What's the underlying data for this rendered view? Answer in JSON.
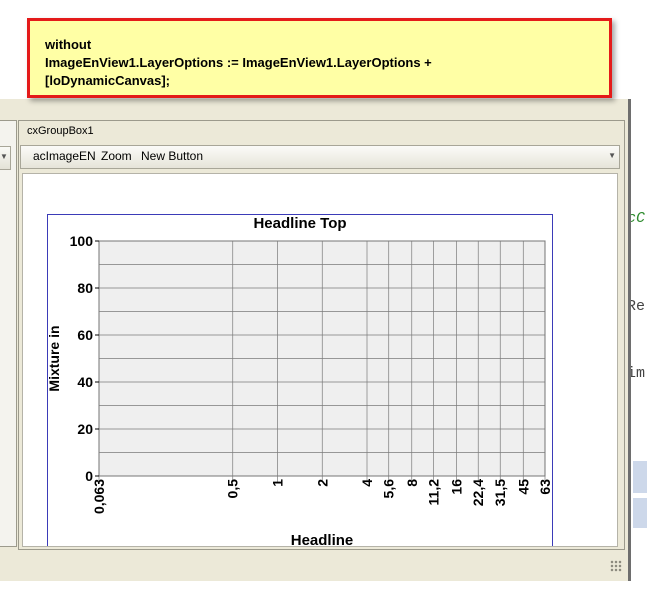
{
  "callout": {
    "lines": [
      "without",
      "ImageEnView1.LayerOptions := ImageEnView1.LayerOptions +",
      "[loDynamicCanvas];"
    ]
  },
  "code_fragments": [
    "cC",
    "Re",
    "im"
  ],
  "window": {
    "groupbox_caption": "cxGroupBox1",
    "toolbar": {
      "items": [
        "acImageEN",
        "Zoom",
        "New Button"
      ]
    }
  },
  "chart_data": {
    "type": "line",
    "title": "Headline Top",
    "xlabel": "Headline",
    "ylabel": "Mixture in",
    "x_scale": "log",
    "x_ticks": [
      "0,063",
      "0,5",
      "1",
      "2",
      "4",
      "5,6",
      "8",
      "11,2",
      "16",
      "22,4",
      "31,5",
      "45",
      "63"
    ],
    "x_tick_values": [
      0.063,
      0.5,
      1,
      2,
      4,
      5.6,
      8,
      11.2,
      16,
      22.4,
      31.5,
      45,
      63
    ],
    "y_ticks": [
      "0",
      "20",
      "40",
      "60",
      "80",
      "100"
    ],
    "ylim": [
      0,
      100
    ],
    "grid": true,
    "series": []
  },
  "colors": {
    "callout_border": "#e41a1a",
    "callout_fill": "#ffffa5",
    "plot_background": "#efefef",
    "frame_border": "#3b3bb8"
  }
}
